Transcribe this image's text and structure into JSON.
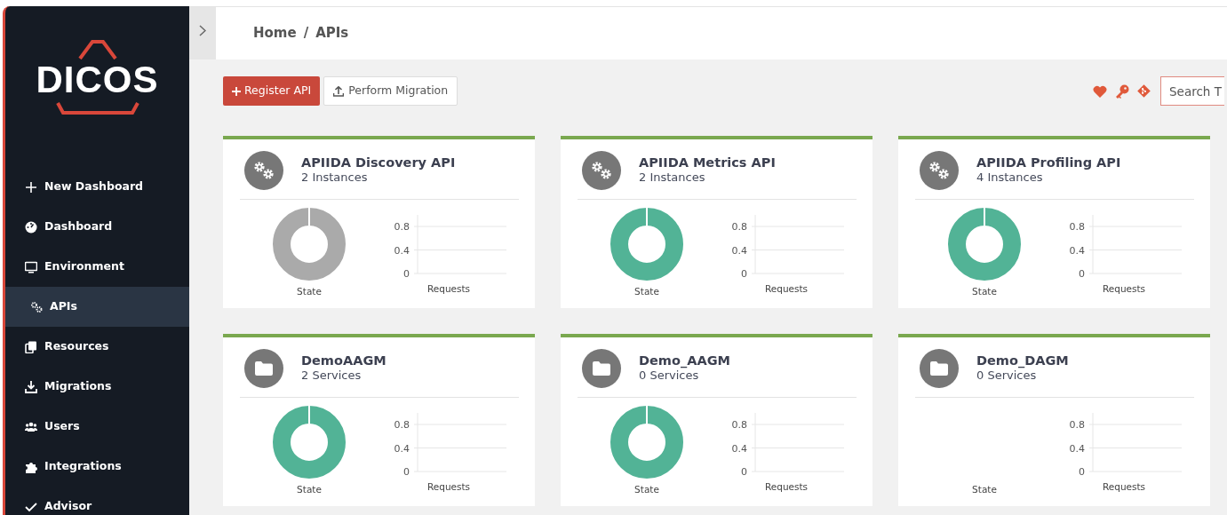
{
  "sidebar": {
    "logo": "DICOS",
    "items": [
      {
        "label": "New Dashboard",
        "selected": false
      },
      {
        "label": "Dashboard",
        "selected": false
      },
      {
        "label": "Environment",
        "selected": false
      },
      {
        "label": "APIs",
        "selected": true
      },
      {
        "label": "Resources",
        "selected": false
      },
      {
        "label": "Migrations",
        "selected": false
      },
      {
        "label": "Users",
        "selected": false
      },
      {
        "label": "Integrations",
        "selected": false
      },
      {
        "label": "Advisor",
        "selected": false
      }
    ]
  },
  "breadcrumb": {
    "items": [
      "Home",
      "APIs"
    ],
    "separator": "/"
  },
  "toolbar": {
    "buttons": [
      {
        "label": "Register API",
        "kind": "primary"
      },
      {
        "label": "Perform Migration",
        "kind": "upload"
      }
    ],
    "search": {
      "placeholder": "Search T"
    }
  },
  "cards": [
    {
      "kind": "api",
      "title": "APIIDA Discovery API",
      "subtitle": "2 Instances",
      "state_label": "State",
      "donut": {
        "color": "#aaaaaa"
      },
      "requests": {
        "y_ticks": [
          "0.8",
          "0.4",
          "0"
        ],
        "label": "Requests"
      }
    },
    {
      "kind": "api",
      "title": "APIIDA Metrics API",
      "subtitle": "2 Instances",
      "state_label": "State",
      "donut": {
        "color": "#52b396"
      },
      "requests": {
        "y_ticks": [
          "0.8",
          "0.4",
          "0"
        ],
        "label": "Requests"
      }
    },
    {
      "kind": "api",
      "title": "APIIDA Profiling API",
      "subtitle": "4 Instances",
      "state_label": "State",
      "donut": {
        "color": "#52b396"
      },
      "requests": {
        "y_ticks": [
          "0.8",
          "0.4",
          "0"
        ],
        "label": "Requests"
      }
    },
    {
      "kind": "group",
      "title": "DemoAAGM",
      "subtitle": "2 Services",
      "state_label": "State",
      "donut": {
        "color": "#52b396"
      },
      "requests": {
        "y_ticks": [
          "0.8",
          "0.4",
          "0"
        ],
        "label": "Requests"
      }
    },
    {
      "kind": "group",
      "title": "Demo_AAGM",
      "subtitle": "0 Services",
      "state_label": "State",
      "donut": {
        "color": "#52b396"
      },
      "requests": {
        "y_ticks": [
          "0.8",
          "0.4",
          "0"
        ],
        "label": "Requests"
      }
    },
    {
      "kind": "group",
      "title": "Demo_DAGM",
      "subtitle": "0 Services",
      "state_label": "State",
      "requests": {
        "y_ticks": [
          "0.8",
          "0.4",
          "0"
        ],
        "label": "Requests"
      }
    }
  ]
}
